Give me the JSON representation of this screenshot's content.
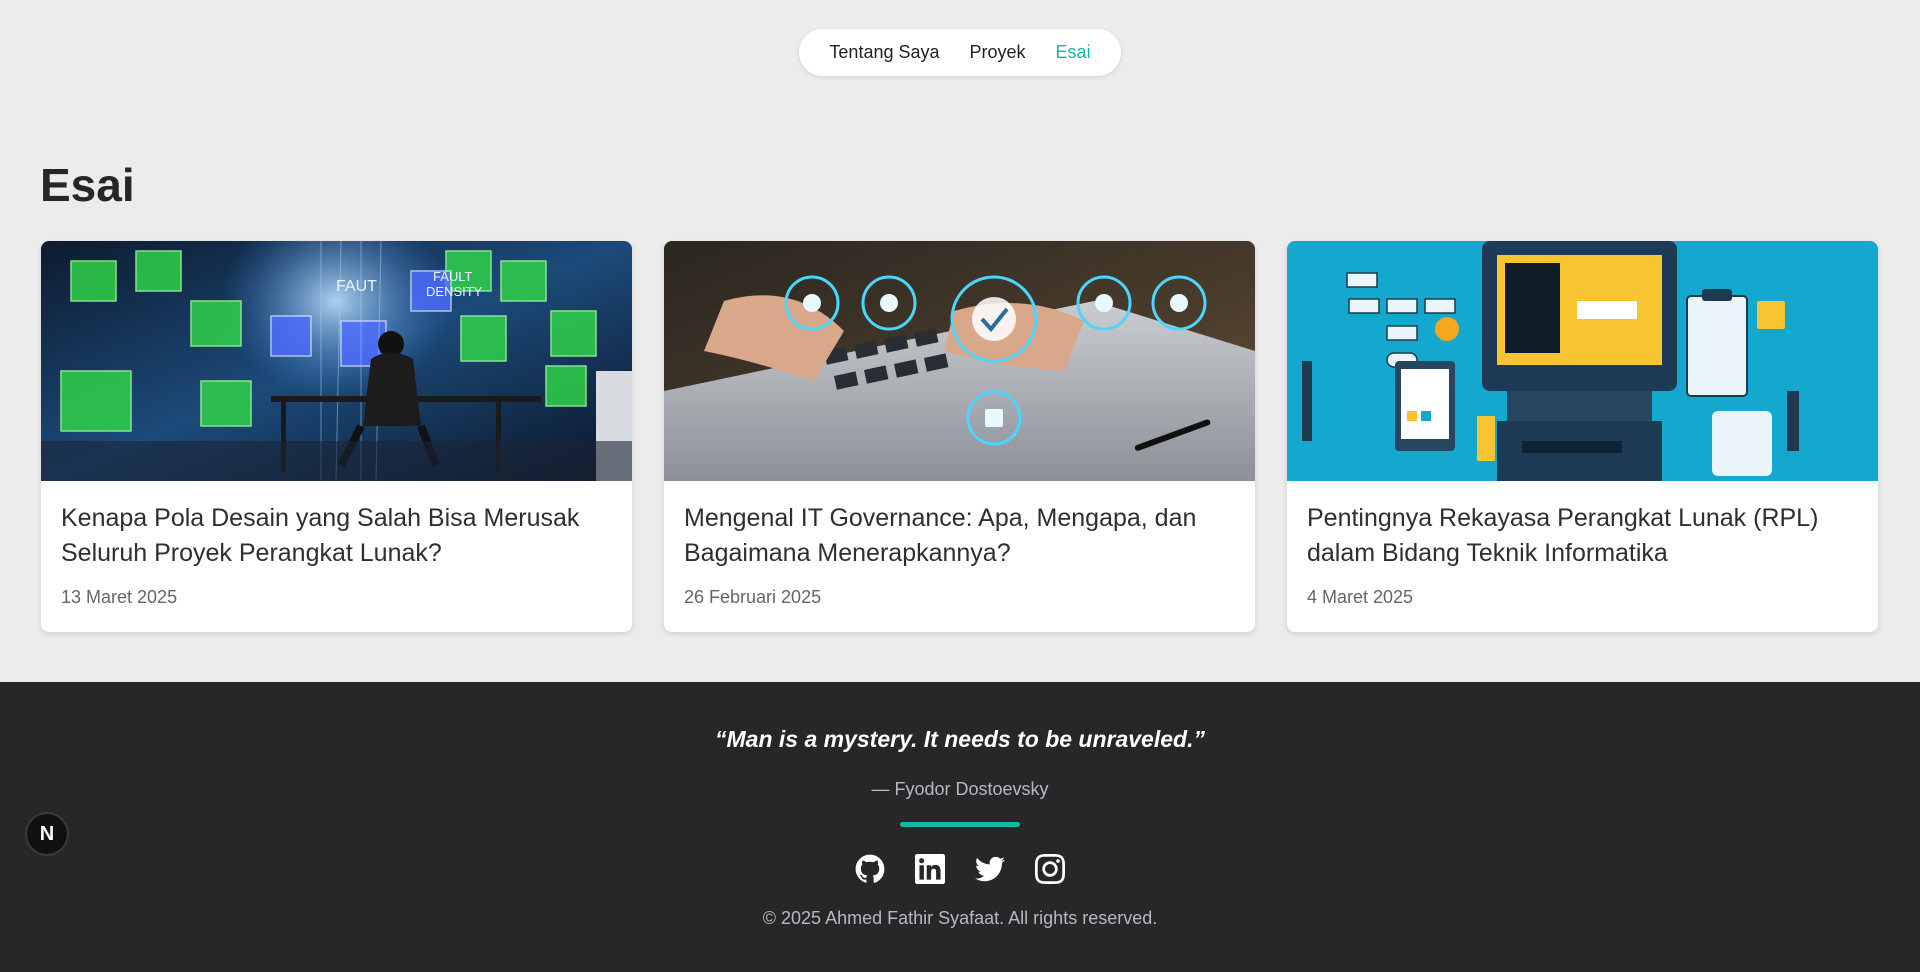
{
  "nav": {
    "items": [
      {
        "label": "Tentang Saya",
        "active": false
      },
      {
        "label": "Proyek",
        "active": false
      },
      {
        "label": "Esai",
        "active": true
      }
    ],
    "accent_color": "#14b8a6"
  },
  "page": {
    "title": "Esai"
  },
  "essays": [
    {
      "title": "Kenapa Pola Desain yang Salah Bisa Merusak Seluruh Proyek Perangkat Lunak?",
      "date": "13 Maret 2025"
    },
    {
      "title": "Mengenal IT Governance: Apa, Mengapa, dan Bagaimana Menerapkannya?",
      "date": "26 Februari 2025"
    },
    {
      "title": "Pentingnya Rekayasa Perangkat Lunak (RPL) dalam Bidang Teknik Informatika",
      "date": "4 Maret 2025"
    }
  ],
  "footer": {
    "quote": "“Man is a mystery. It needs to be unraveled.”",
    "author": "— Fyodor Dostoevsky",
    "socials": [
      {
        "icon": "github-icon"
      },
      {
        "icon": "linkedin-icon"
      },
      {
        "icon": "twitter-icon"
      },
      {
        "icon": "instagram-icon"
      }
    ],
    "copyright": "© 2025 Ahmed Fathir Syafaat. All rights reserved.",
    "background_color": "#27272a"
  },
  "dev_badge": {
    "label": "N"
  }
}
